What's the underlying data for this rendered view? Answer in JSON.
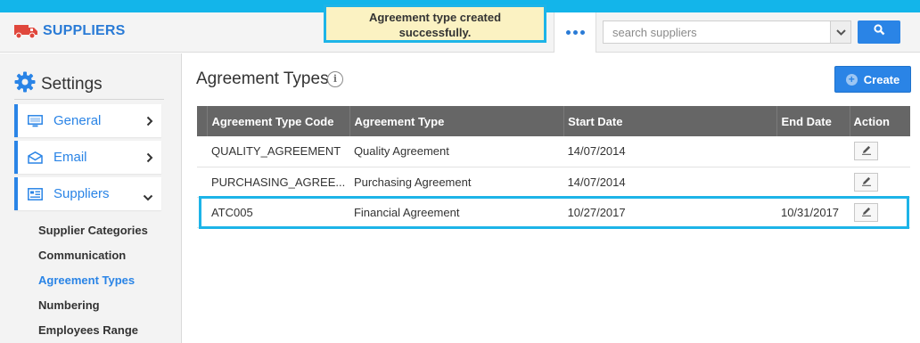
{
  "header": {
    "brand_title": "SUPPLIERS",
    "toast_line1": "Agreement type created",
    "toast_line2": "successfully.",
    "search_placeholder": "search suppliers",
    "more_icon": "ellipsis-icon",
    "search_icon": "search-icon",
    "brand_icon": "truck-icon"
  },
  "sidebar": {
    "title": "Settings",
    "items": [
      {
        "label": "General",
        "icon": "monitor-icon"
      },
      {
        "label": "Email",
        "icon": "envelope-icon"
      },
      {
        "label": "Suppliers",
        "icon": "list-icon"
      }
    ],
    "sub_items": [
      {
        "label": "Supplier Categories"
      },
      {
        "label": "Communication"
      },
      {
        "label": "Agreement Types"
      },
      {
        "label": "Numbering"
      },
      {
        "label": "Employees Range"
      }
    ]
  },
  "main": {
    "title": "Agreement Types",
    "create_label": "Create",
    "columns": [
      "",
      "Agreement Type Code",
      "Agreement Type",
      "Start Date",
      "End Date",
      "Action"
    ],
    "rows": [
      {
        "code": "QUALITY_AGREEMENT",
        "type": "Quality Agreement",
        "start": "14/07/2014",
        "end": ""
      },
      {
        "code": "PURCHASING_AGREE...",
        "type": "Purchasing Agreement",
        "start": "14/07/2014",
        "end": ""
      },
      {
        "code": "ATC005",
        "type": "Financial Agreement",
        "start": "10/27/2017",
        "end": "10/31/2017"
      }
    ]
  },
  "colors": {
    "accent": "#2a84e6",
    "top_strip": "#13b5ea",
    "toast_bg": "#fbf2c2",
    "highlight_border": "#1db4e8",
    "table_header": "#666666"
  }
}
